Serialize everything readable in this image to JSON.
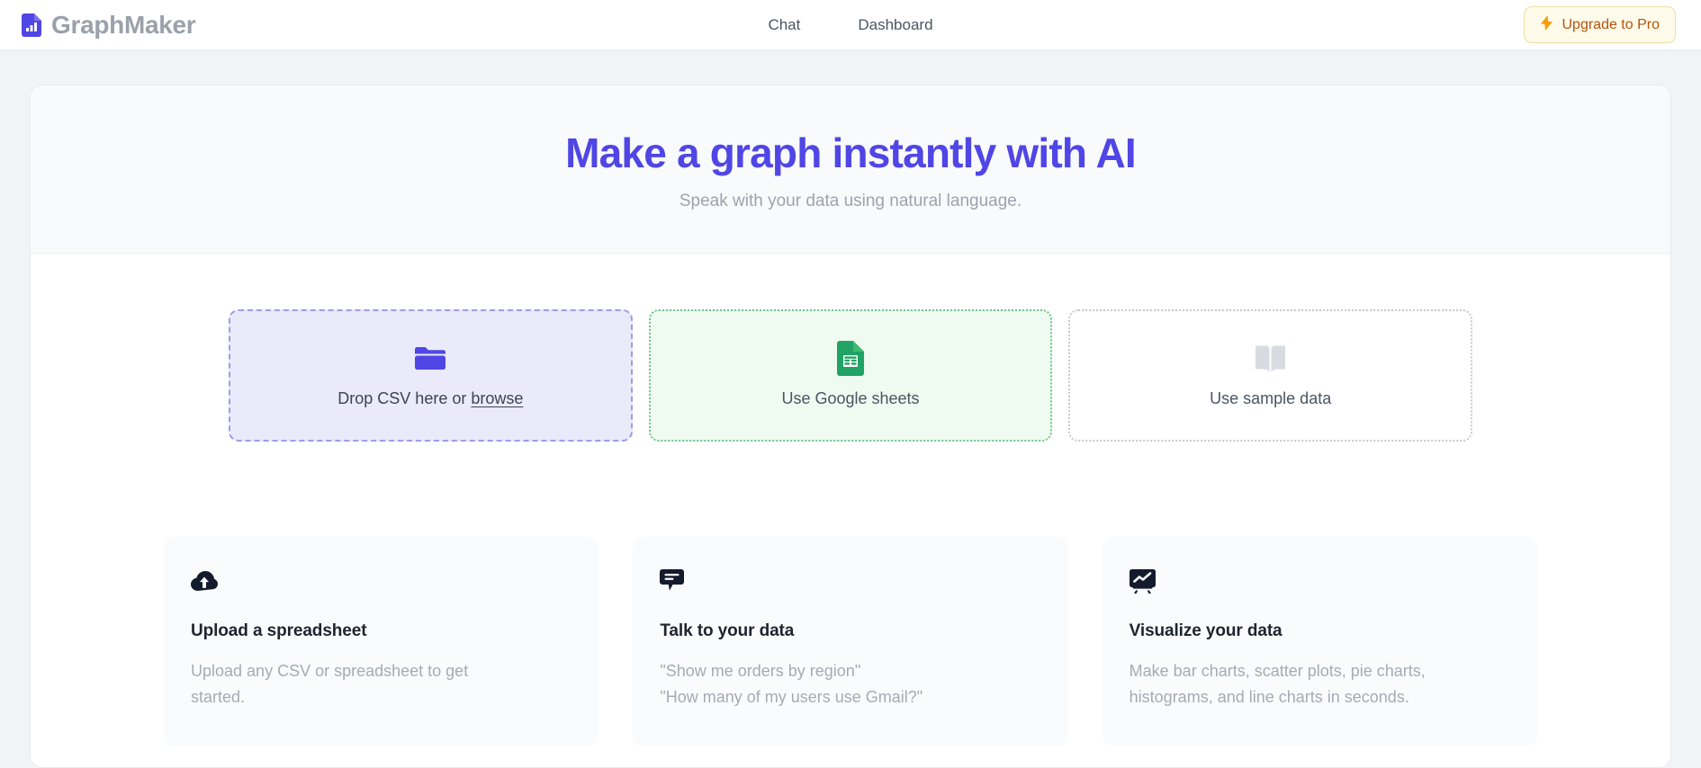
{
  "header": {
    "brand_name": "GraphMaker",
    "brand_icon": "chart-document-icon",
    "nav": [
      {
        "label": "Chat",
        "name": "nav-chat"
      },
      {
        "label": "Dashboard",
        "name": "nav-dashboard"
      }
    ],
    "upgrade": {
      "label": "Upgrade to Pro",
      "icon": "lightning-bolt-icon"
    }
  },
  "hero": {
    "title": "Make a graph instantly with AI",
    "subtitle": "Speak with your data using natural language.",
    "title_color": "#4f46e5"
  },
  "sources": [
    {
      "name": "drop-csv-card",
      "icon": "folder-icon",
      "label_prefix": "Drop CSV here or ",
      "label_link": "browse",
      "accent": "#4f46e5",
      "background": "#eaeafb",
      "border_style": "dashed"
    },
    {
      "name": "google-sheets-card",
      "icon": "google-sheets-icon",
      "label": "Use Google sheets",
      "accent": "#21a366",
      "background": "#effaf1",
      "border_style": "dotted"
    },
    {
      "name": "sample-data-card",
      "icon": "book-icon",
      "label": "Use sample data",
      "accent": "#d5d8dc",
      "background": "#ffffff",
      "border_style": "dotted"
    }
  ],
  "features": [
    {
      "name": "feature-upload",
      "icon": "cloud-upload-icon",
      "title": "Upload a spreadsheet",
      "desc_lines": [
        "Upload any CSV or spreadsheet to get",
        "started."
      ]
    },
    {
      "name": "feature-talk",
      "icon": "chat-bubble-icon",
      "title": "Talk to your data",
      "desc_lines": [
        "\"Show me orders by region\"",
        "\"How many of my users use Gmail?\""
      ]
    },
    {
      "name": "feature-visualize",
      "icon": "presentation-chart-icon",
      "title": "Visualize your data",
      "desc_lines": [
        "Make bar charts, scatter plots, pie charts,",
        "histograms, and line charts in seconds."
      ]
    }
  ]
}
